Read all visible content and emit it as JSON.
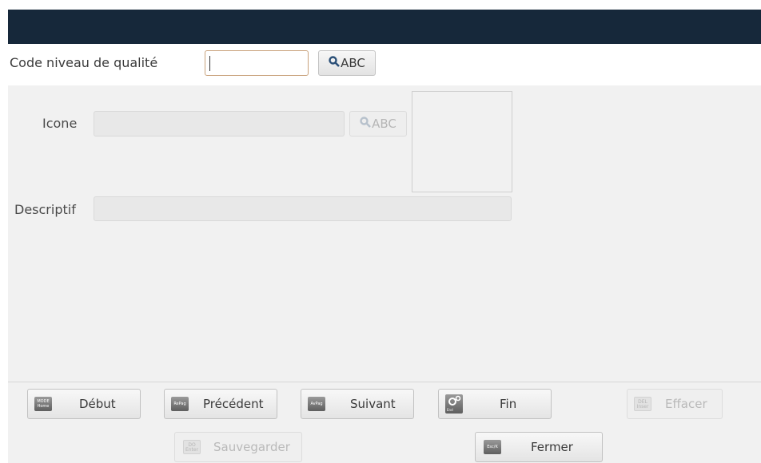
{
  "form": {
    "code_label": "Code niveau de qualité",
    "code_value": "",
    "code_lookup": "ABC",
    "icone_label": "Icone",
    "icone_value": "",
    "icone_lookup": "ABC",
    "descriptif_label": "Descriptif",
    "descriptif_value": ""
  },
  "buttons": {
    "debut": {
      "key": "MODE",
      "key_sub": "Home",
      "label": "Début"
    },
    "precedent": {
      "key": "RePag",
      "label": "Précédent"
    },
    "suivant": {
      "key": "AvPag",
      "label": "Suivant"
    },
    "fin": {
      "key": "End",
      "label": "Fin"
    },
    "effacer": {
      "key": "DEL",
      "key_sub": "Inser",
      "label": "Effacer"
    },
    "sauvegarder": {
      "key": "DO",
      "key_sub": "Enter",
      "label": "Sauvegarder"
    },
    "fermer": {
      "key": "Esc/K",
      "label": "Fermer"
    }
  },
  "colors": {
    "titlebar": "#16283a",
    "panel": "#f1f1f1",
    "active_input_border": "#c9a27c"
  }
}
